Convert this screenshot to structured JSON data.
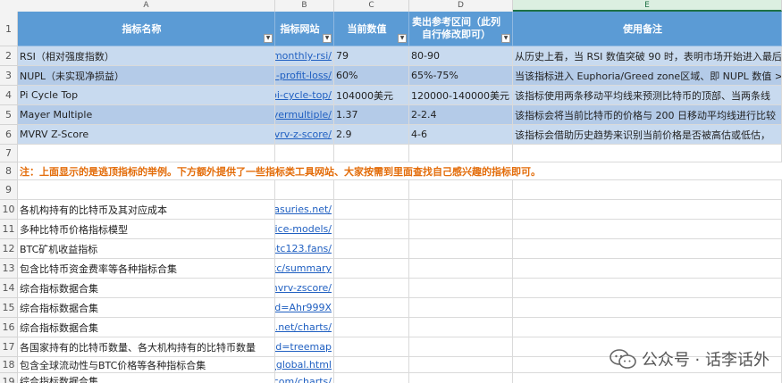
{
  "columns": [
    "A",
    "B",
    "C",
    "D",
    "E"
  ],
  "headers": {
    "a": "指标名称",
    "b": "指标网站",
    "c": "当前数值",
    "d1": "卖出参考区间（此列",
    "d2": "自行修改即可）",
    "e": "使用备注",
    "dropdown_icon": "dropdown-arrow-icon"
  },
  "rows": [
    {
      "n": "1"
    },
    {
      "n": "2",
      "a": "RSI（相对强度指数）",
      "b": "monthly-rsi/",
      "c": "79",
      "d": "80-90",
      "e": "从历史上看，当 RSI 数值突破 90 时，表明市场开始进入最后"
    },
    {
      "n": "3",
      "a": "NUPL（未实现净损益）",
      "b": "l-profit-loss/",
      "c": "60%",
      "d": "65%-75%",
      "e": "当该指标进入 Euphoria/Greed zone区域、即 NUPL 数值 >7"
    },
    {
      "n": "4",
      "a": "Pi Cycle Top",
      "b": "pi-cycle-top/",
      "c": "104000美元",
      "d": "120000-140000美元",
      "e": "该指标使用两条移动平均线来预测比特币的顶部、当两条线"
    },
    {
      "n": "5",
      "a": "Mayer Multiple",
      "b": "ayermultiple/",
      "c": "1.37",
      "d": "2-2.4",
      "e": "该指标会将当前比特币的价格与 200 日移动平均线进行比较"
    },
    {
      "n": "6",
      "a": "MVRV Z-Score",
      "b": "nvrv-z-score/",
      "c": "2.9",
      "d": "4-6",
      "e": "该指标会借助历史趋势来识别当前价格是否被高估或低估，"
    },
    {
      "n": "7"
    },
    {
      "n": "8",
      "note": "注：上面显示的是逃顶指标的举例。下方额外提供了一些指标类工具网站、大家按需到里面查找自己感兴趣的指标即可。"
    },
    {
      "n": "9"
    },
    {
      "n": "10",
      "a": "各机构持有的比特币及其对应成本",
      "b": "easuries.net/"
    },
    {
      "n": "11",
      "a": "多种比特币价格指标模型",
      "b": "rice-models/"
    },
    {
      "n": "12",
      "a": "BTC矿机收益指标",
      "b": ".btc123.fans/"
    },
    {
      "n": "13",
      "a": "包含比特币资金费率等各种指标合集",
      "b": "otc/summary"
    },
    {
      "n": "14",
      "a": "综合指标数据合集",
      "b": "mvrv-zscore/"
    },
    {
      "n": "15",
      "a": "综合指标数据合集",
      "b": "tld=Ahr999X"
    },
    {
      "n": "16",
      "a": "综合指标数据合集",
      "b": "n.net/charts/"
    },
    {
      "n": "17",
      "a": "各国家持有的比特币数量、各大机构持有的比特币数量",
      "b": "ted=treemap"
    },
    {
      "n": "18",
      "a": "包含全球流动性与BTC价格等各种指标合集",
      "b": "2_global.html"
    },
    {
      "n": "19",
      "a": "综合指标数据合集",
      "b": ".com/charts/"
    }
  ],
  "watermark": {
    "icon": "wechat-icon",
    "text": "公众号 · 话李话外"
  },
  "colors": {
    "header": "#5b9bd5",
    "row_light": "#c8daef",
    "row_dark": "#b4cbe8",
    "note": "#e36c09",
    "link": "#1f5fc1"
  }
}
